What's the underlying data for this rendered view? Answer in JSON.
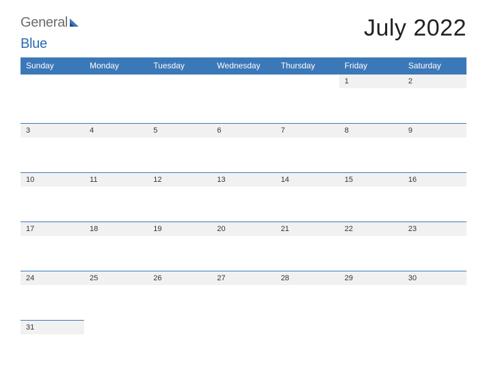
{
  "brand": {
    "word1": "General",
    "word2": "Blue"
  },
  "title": "July 2022",
  "days_of_week": [
    "Sunday",
    "Monday",
    "Tuesday",
    "Wednesday",
    "Thursday",
    "Friday",
    "Saturday"
  ],
  "weeks": [
    [
      "",
      "",
      "",
      "",
      "",
      "1",
      "2"
    ],
    [
      "3",
      "4",
      "5",
      "6",
      "7",
      "8",
      "9"
    ],
    [
      "10",
      "11",
      "12",
      "13",
      "14",
      "15",
      "16"
    ],
    [
      "17",
      "18",
      "19",
      "20",
      "21",
      "22",
      "23"
    ],
    [
      "24",
      "25",
      "26",
      "27",
      "28",
      "29",
      "30"
    ],
    [
      "31",
      "",
      "",
      "",
      "",
      "",
      ""
    ]
  ]
}
